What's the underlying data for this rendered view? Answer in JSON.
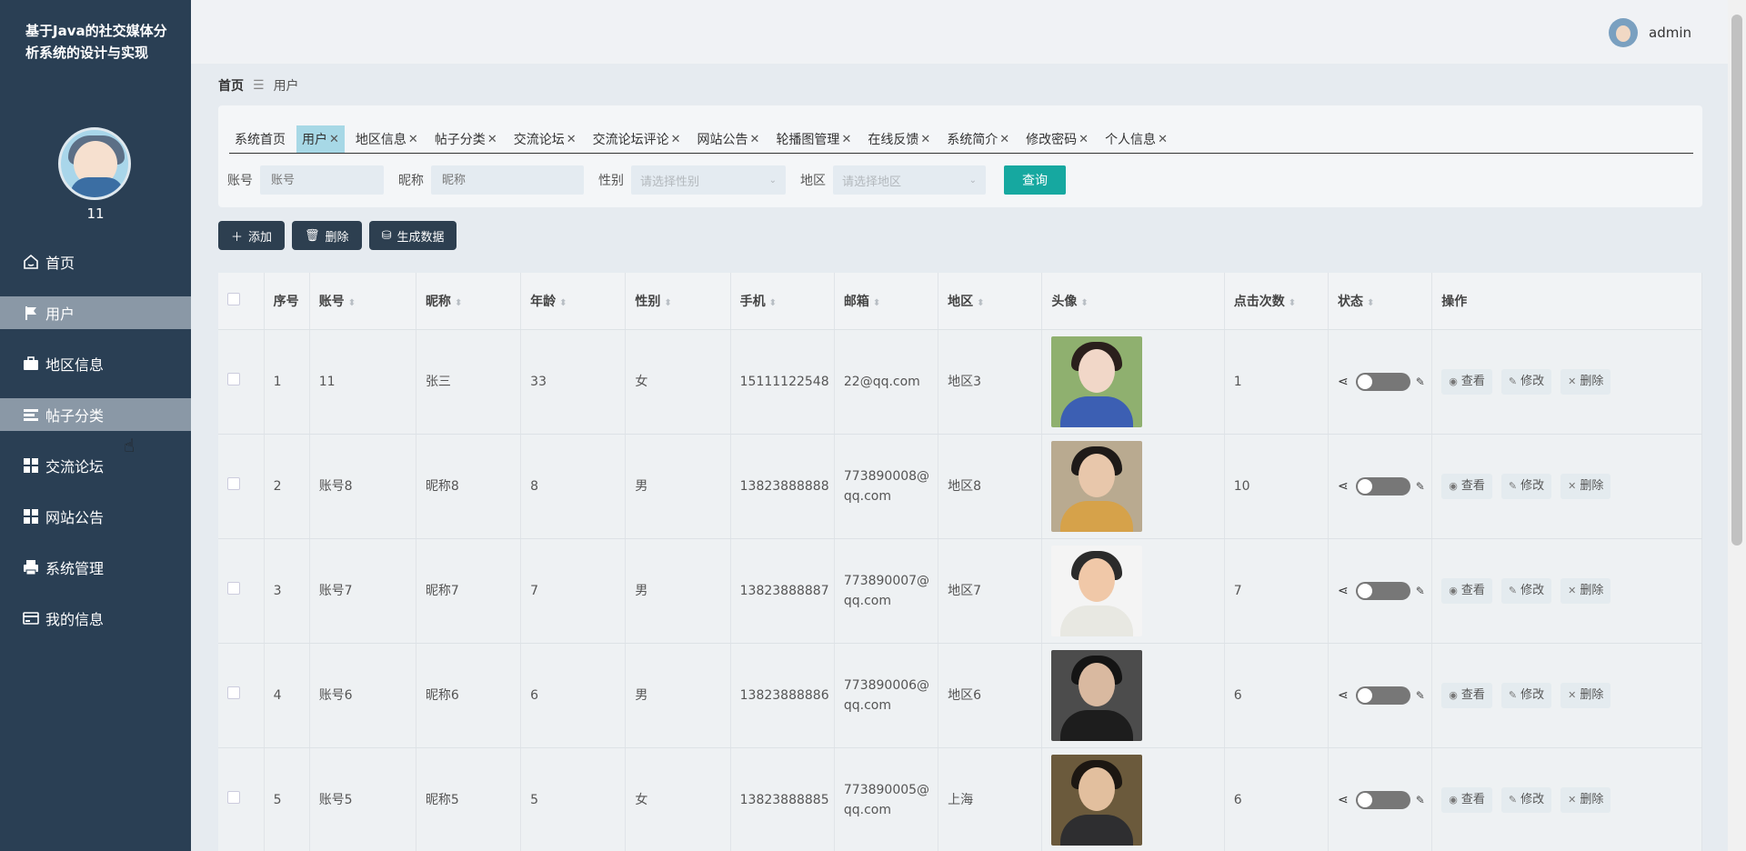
{
  "app": {
    "title": "基于Java的社交媒体分析系统的设计与实现"
  },
  "sidebar": {
    "username": "11",
    "items": [
      {
        "label": "首页",
        "icon": "home-icon",
        "active": false
      },
      {
        "label": "用户",
        "icon": "flag-icon",
        "active": true
      },
      {
        "label": "地区信息",
        "icon": "briefcase-icon",
        "active": false
      },
      {
        "label": "帖子分类",
        "icon": "list-icon",
        "active": true
      },
      {
        "label": "交流论坛",
        "icon": "grid-icon",
        "active": false
      },
      {
        "label": "网站公告",
        "icon": "grid-icon",
        "active": false
      },
      {
        "label": "系统管理",
        "icon": "printer-icon",
        "active": false
      },
      {
        "label": "我的信息",
        "icon": "card-icon",
        "active": false
      }
    ]
  },
  "header": {
    "user": "admin"
  },
  "breadcrumb": {
    "home": "首页",
    "separator": "☰",
    "current": "用户"
  },
  "tabs": [
    {
      "label": "系统首页",
      "closable": false,
      "active": false
    },
    {
      "label": "用户",
      "closable": true,
      "active": true
    },
    {
      "label": "地区信息",
      "closable": true,
      "active": false
    },
    {
      "label": "帖子分类",
      "closable": true,
      "active": false
    },
    {
      "label": "交流论坛",
      "closable": true,
      "active": false
    },
    {
      "label": "交流论坛评论",
      "closable": true,
      "active": false
    },
    {
      "label": "网站公告",
      "closable": true,
      "active": false
    },
    {
      "label": "轮播图管理",
      "closable": true,
      "active": false
    },
    {
      "label": "在线反馈",
      "closable": true,
      "active": false
    },
    {
      "label": "系统简介",
      "closable": true,
      "active": false
    },
    {
      "label": "修改密码",
      "closable": true,
      "active": false
    },
    {
      "label": "个人信息",
      "closable": true,
      "active": false
    }
  ],
  "filters": {
    "account_label": "账号",
    "account_placeholder": "账号",
    "nickname_label": "昵称",
    "nickname_placeholder": "昵称",
    "gender_label": "性别",
    "gender_placeholder": "请选择性别",
    "region_label": "地区",
    "region_placeholder": "请选择地区",
    "query_label": "查询"
  },
  "actions": {
    "add": "添加",
    "delete": "删除",
    "generate": "生成数据"
  },
  "table": {
    "headers": [
      "序号",
      "账号",
      "昵称",
      "年龄",
      "性别",
      "手机",
      "邮箱",
      "地区",
      "头像",
      "点击次数",
      "状态",
      "操作"
    ],
    "op_labels": {
      "view": "查看",
      "edit": "修改",
      "delete": "删除"
    },
    "rows": [
      {
        "no": "1",
        "account": "11",
        "nickname": "张三",
        "age": "33",
        "gender": "女",
        "phone": "15111122548",
        "email": "22@qq.com",
        "region": "地区3",
        "clicks": "1",
        "photo": {
          "bg": "#8fb06f",
          "hair": "#2a1f1c",
          "skin": "#f1d7c8",
          "cloth": "#3c5fb3"
        }
      },
      {
        "no": "2",
        "account": "账号8",
        "nickname": "昵称8",
        "age": "8",
        "gender": "男",
        "phone": "13823888888",
        "email": "773890008@qq.com",
        "region": "地区8",
        "clicks": "10",
        "photo": {
          "bg": "#b9aa90",
          "hair": "#1e1a18",
          "skin": "#e8c7ab",
          "cloth": "#d6a24a"
        }
      },
      {
        "no": "3",
        "account": "账号7",
        "nickname": "昵称7",
        "age": "7",
        "gender": "男",
        "phone": "13823888887",
        "email": "773890007@qq.com",
        "region": "地区7",
        "clicks": "7",
        "photo": {
          "bg": "#f4f4f4",
          "hair": "#2b2b2b",
          "skin": "#f0c8a8",
          "cloth": "#e8e8e2"
        }
      },
      {
        "no": "4",
        "account": "账号6",
        "nickname": "昵称6",
        "age": "6",
        "gender": "男",
        "phone": "13823888886",
        "email": "773890006@qq.com",
        "region": "地区6",
        "clicks": "6",
        "photo": {
          "bg": "#4c4c4c",
          "hair": "#141414",
          "skin": "#d9b9a0",
          "cloth": "#1d1d1d"
        }
      },
      {
        "no": "5",
        "account": "账号5",
        "nickname": "昵称5",
        "age": "5",
        "gender": "女",
        "phone": "13823888885",
        "email": "773890005@qq.com",
        "region": "上海",
        "clicks": "6",
        "photo": {
          "bg": "#6b5a3c",
          "hair": "#1c1712",
          "skin": "#e2bf9e",
          "cloth": "#2e2e30"
        }
      }
    ]
  }
}
